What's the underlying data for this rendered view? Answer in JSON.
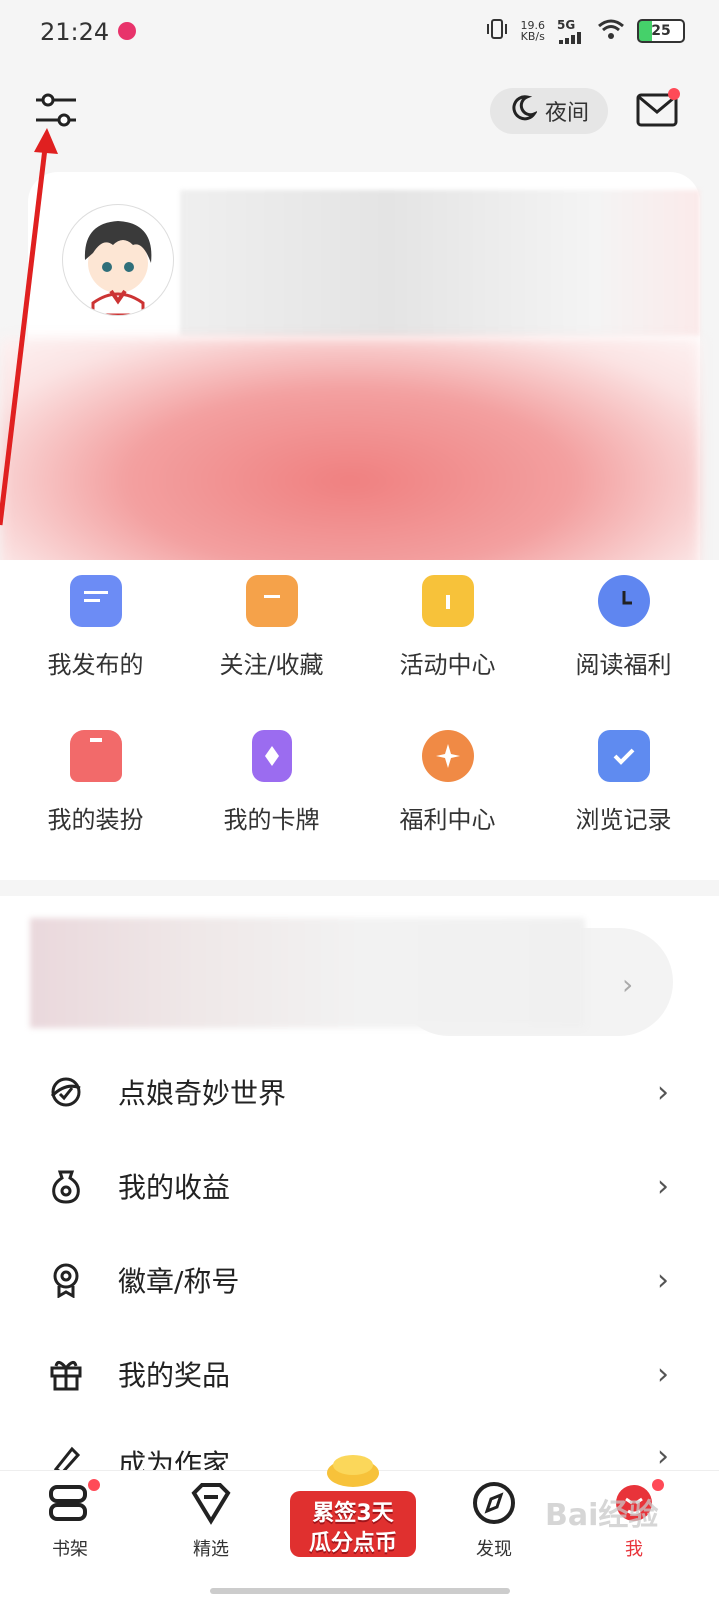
{
  "status_bar": {
    "time": "21:24",
    "net_speed_value": "19.6",
    "net_speed_unit": "KB/s",
    "network": "5G",
    "battery": "25"
  },
  "header": {
    "night_label": "夜间"
  },
  "grid": [
    {
      "label": "我发布的",
      "icon": "message-icon",
      "color": "#6c8cf5"
    },
    {
      "label": "关注/收藏",
      "icon": "folder-icon",
      "color": "#f5a24a"
    },
    {
      "label": "活动中心",
      "icon": "gift-icon",
      "color": "#f7c23a"
    },
    {
      "label": "阅读福利",
      "icon": "clock-bag-icon",
      "color": "#5f86f0"
    },
    {
      "label": "我的装扮",
      "icon": "tshirt-icon",
      "color": "#f26a6a"
    },
    {
      "label": "我的卡牌",
      "icon": "card-icon",
      "color": "#9b6cf0"
    },
    {
      "label": "福利中心",
      "icon": "star-bag-icon",
      "color": "#f08a45"
    },
    {
      "label": "浏览记录",
      "icon": "book-check-icon",
      "color": "#5f8bf0"
    }
  ],
  "menu": [
    {
      "label": "点娘奇妙世界",
      "icon": "world-icon"
    },
    {
      "label": "我的收益",
      "icon": "money-bag-icon"
    },
    {
      "label": "徽章/称号",
      "icon": "badge-icon"
    },
    {
      "label": "我的奖品",
      "icon": "gift-box-icon"
    },
    {
      "label": "成为作家",
      "icon": "pen-icon"
    }
  ],
  "bottom_nav": [
    {
      "label": "书架",
      "icon": "bookshelf-icon"
    },
    {
      "label": "精选",
      "icon": "diamond-icon"
    },
    {
      "label": "发现",
      "icon": "compass-icon"
    },
    {
      "label": "我",
      "icon": "profile-icon"
    }
  ],
  "promo": {
    "line1": "累签3天",
    "line2": "瓜分点币"
  },
  "watermark": "Bai经验"
}
